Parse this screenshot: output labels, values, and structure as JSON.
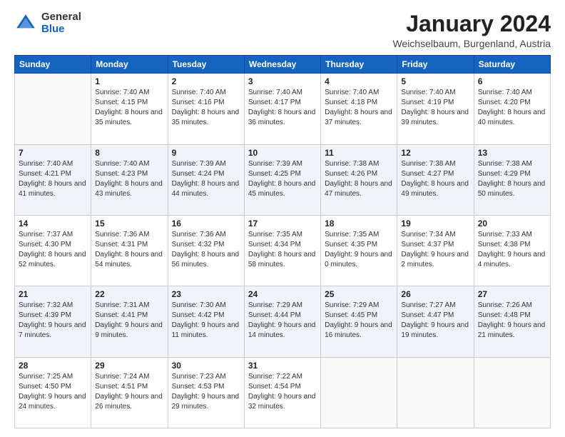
{
  "logo": {
    "general": "General",
    "blue": "Blue"
  },
  "header": {
    "title": "January 2024",
    "subtitle": "Weichselbaum, Burgenland, Austria"
  },
  "weekdays": [
    "Sunday",
    "Monday",
    "Tuesday",
    "Wednesday",
    "Thursday",
    "Friday",
    "Saturday"
  ],
  "weeks": [
    [
      {
        "day": "",
        "sunrise": "",
        "sunset": "",
        "daylight": ""
      },
      {
        "day": "1",
        "sunrise": "Sunrise: 7:40 AM",
        "sunset": "Sunset: 4:15 PM",
        "daylight": "Daylight: 8 hours and 35 minutes."
      },
      {
        "day": "2",
        "sunrise": "Sunrise: 7:40 AM",
        "sunset": "Sunset: 4:16 PM",
        "daylight": "Daylight: 8 hours and 35 minutes."
      },
      {
        "day": "3",
        "sunrise": "Sunrise: 7:40 AM",
        "sunset": "Sunset: 4:17 PM",
        "daylight": "Daylight: 8 hours and 36 minutes."
      },
      {
        "day": "4",
        "sunrise": "Sunrise: 7:40 AM",
        "sunset": "Sunset: 4:18 PM",
        "daylight": "Daylight: 8 hours and 37 minutes."
      },
      {
        "day": "5",
        "sunrise": "Sunrise: 7:40 AM",
        "sunset": "Sunset: 4:19 PM",
        "daylight": "Daylight: 8 hours and 39 minutes."
      },
      {
        "day": "6",
        "sunrise": "Sunrise: 7:40 AM",
        "sunset": "Sunset: 4:20 PM",
        "daylight": "Daylight: 8 hours and 40 minutes."
      }
    ],
    [
      {
        "day": "7",
        "sunrise": "Sunrise: 7:40 AM",
        "sunset": "Sunset: 4:21 PM",
        "daylight": "Daylight: 8 hours and 41 minutes."
      },
      {
        "day": "8",
        "sunrise": "Sunrise: 7:40 AM",
        "sunset": "Sunset: 4:23 PM",
        "daylight": "Daylight: 8 hours and 43 minutes."
      },
      {
        "day": "9",
        "sunrise": "Sunrise: 7:39 AM",
        "sunset": "Sunset: 4:24 PM",
        "daylight": "Daylight: 8 hours and 44 minutes."
      },
      {
        "day": "10",
        "sunrise": "Sunrise: 7:39 AM",
        "sunset": "Sunset: 4:25 PM",
        "daylight": "Daylight: 8 hours and 45 minutes."
      },
      {
        "day": "11",
        "sunrise": "Sunrise: 7:38 AM",
        "sunset": "Sunset: 4:26 PM",
        "daylight": "Daylight: 8 hours and 47 minutes."
      },
      {
        "day": "12",
        "sunrise": "Sunrise: 7:38 AM",
        "sunset": "Sunset: 4:27 PM",
        "daylight": "Daylight: 8 hours and 49 minutes."
      },
      {
        "day": "13",
        "sunrise": "Sunrise: 7:38 AM",
        "sunset": "Sunset: 4:29 PM",
        "daylight": "Daylight: 8 hours and 50 minutes."
      }
    ],
    [
      {
        "day": "14",
        "sunrise": "Sunrise: 7:37 AM",
        "sunset": "Sunset: 4:30 PM",
        "daylight": "Daylight: 8 hours and 52 minutes."
      },
      {
        "day": "15",
        "sunrise": "Sunrise: 7:36 AM",
        "sunset": "Sunset: 4:31 PM",
        "daylight": "Daylight: 8 hours and 54 minutes."
      },
      {
        "day": "16",
        "sunrise": "Sunrise: 7:36 AM",
        "sunset": "Sunset: 4:32 PM",
        "daylight": "Daylight: 8 hours and 56 minutes."
      },
      {
        "day": "17",
        "sunrise": "Sunrise: 7:35 AM",
        "sunset": "Sunset: 4:34 PM",
        "daylight": "Daylight: 8 hours and 58 minutes."
      },
      {
        "day": "18",
        "sunrise": "Sunrise: 7:35 AM",
        "sunset": "Sunset: 4:35 PM",
        "daylight": "Daylight: 9 hours and 0 minutes."
      },
      {
        "day": "19",
        "sunrise": "Sunrise: 7:34 AM",
        "sunset": "Sunset: 4:37 PM",
        "daylight": "Daylight: 9 hours and 2 minutes."
      },
      {
        "day": "20",
        "sunrise": "Sunrise: 7:33 AM",
        "sunset": "Sunset: 4:38 PM",
        "daylight": "Daylight: 9 hours and 4 minutes."
      }
    ],
    [
      {
        "day": "21",
        "sunrise": "Sunrise: 7:32 AM",
        "sunset": "Sunset: 4:39 PM",
        "daylight": "Daylight: 9 hours and 7 minutes."
      },
      {
        "day": "22",
        "sunrise": "Sunrise: 7:31 AM",
        "sunset": "Sunset: 4:41 PM",
        "daylight": "Daylight: 9 hours and 9 minutes."
      },
      {
        "day": "23",
        "sunrise": "Sunrise: 7:30 AM",
        "sunset": "Sunset: 4:42 PM",
        "daylight": "Daylight: 9 hours and 11 minutes."
      },
      {
        "day": "24",
        "sunrise": "Sunrise: 7:29 AM",
        "sunset": "Sunset: 4:44 PM",
        "daylight": "Daylight: 9 hours and 14 minutes."
      },
      {
        "day": "25",
        "sunrise": "Sunrise: 7:29 AM",
        "sunset": "Sunset: 4:45 PM",
        "daylight": "Daylight: 9 hours and 16 minutes."
      },
      {
        "day": "26",
        "sunrise": "Sunrise: 7:27 AM",
        "sunset": "Sunset: 4:47 PM",
        "daylight": "Daylight: 9 hours and 19 minutes."
      },
      {
        "day": "27",
        "sunrise": "Sunrise: 7:26 AM",
        "sunset": "Sunset: 4:48 PM",
        "daylight": "Daylight: 9 hours and 21 minutes."
      }
    ],
    [
      {
        "day": "28",
        "sunrise": "Sunrise: 7:25 AM",
        "sunset": "Sunset: 4:50 PM",
        "daylight": "Daylight: 9 hours and 24 minutes."
      },
      {
        "day": "29",
        "sunrise": "Sunrise: 7:24 AM",
        "sunset": "Sunset: 4:51 PM",
        "daylight": "Daylight: 9 hours and 26 minutes."
      },
      {
        "day": "30",
        "sunrise": "Sunrise: 7:23 AM",
        "sunset": "Sunset: 4:53 PM",
        "daylight": "Daylight: 9 hours and 29 minutes."
      },
      {
        "day": "31",
        "sunrise": "Sunrise: 7:22 AM",
        "sunset": "Sunset: 4:54 PM",
        "daylight": "Daylight: 9 hours and 32 minutes."
      },
      {
        "day": "",
        "sunrise": "",
        "sunset": "",
        "daylight": ""
      },
      {
        "day": "",
        "sunrise": "",
        "sunset": "",
        "daylight": ""
      },
      {
        "day": "",
        "sunrise": "",
        "sunset": "",
        "daylight": ""
      }
    ]
  ]
}
